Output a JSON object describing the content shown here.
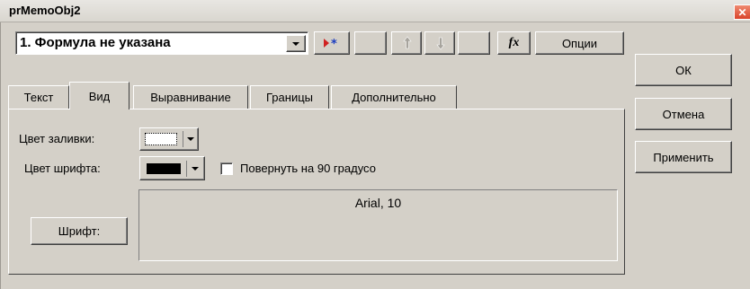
{
  "window": {
    "title": "prMemoObj2",
    "close_glyph": "✕"
  },
  "formula": {
    "selected": "1.  Формула не указана"
  },
  "toolbar": {
    "add_icon": "red-arrow-asterisk-icon",
    "up_icon": "arrow-up-icon",
    "down_icon": "arrow-down-icon",
    "fx_label": "fx",
    "options_label": "Опции"
  },
  "tabs": [
    {
      "label": "Текст"
    },
    {
      "label": "Вид"
    },
    {
      "label": "Выравнивание"
    },
    {
      "label": "Границы"
    },
    {
      "label": "Дополнительно"
    }
  ],
  "view": {
    "fill_color_label": "Цвет заливки:",
    "fill_color": "#ffffff",
    "font_color_label": "Цвет шрифта:",
    "font_color": "#000000",
    "rotate_label": "Повернуть на 90 градусо",
    "rotate_checked": false,
    "font_button_label": "Шрифт:",
    "font_preview": "Arial, 10"
  },
  "buttons": {
    "ok": "ОК",
    "cancel": "Отмена",
    "apply": "Применить"
  }
}
